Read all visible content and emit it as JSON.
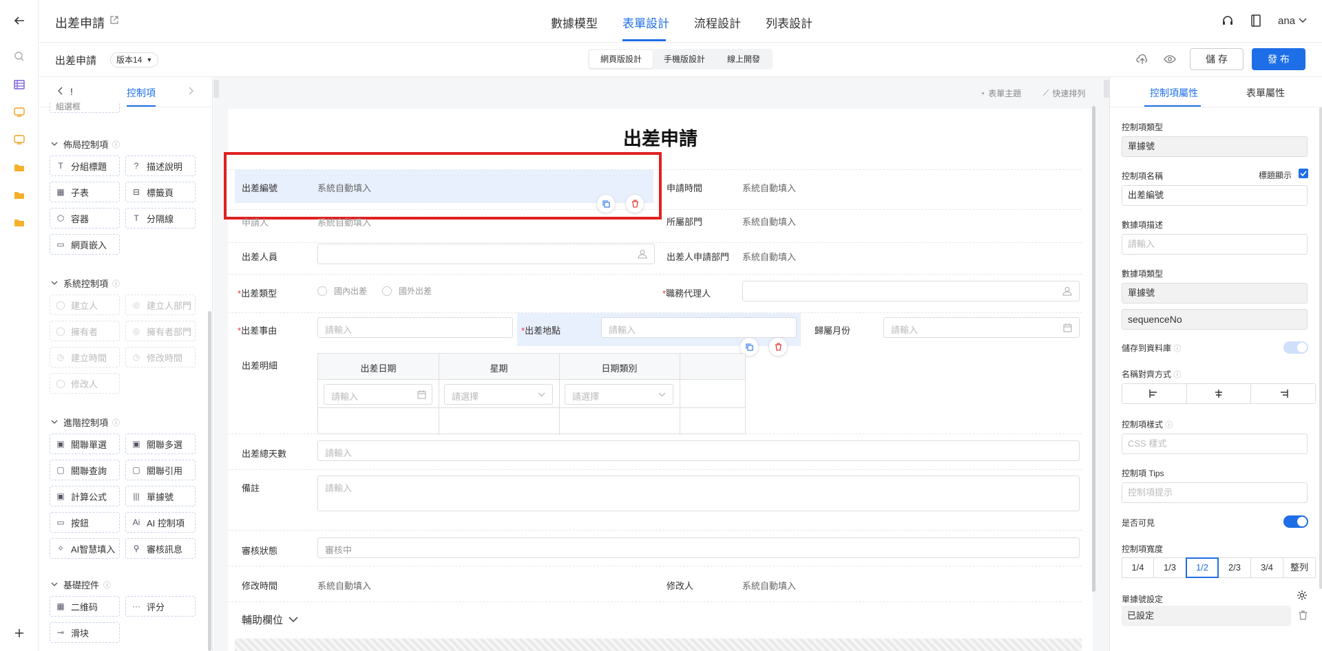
{
  "topbar": {
    "app_title": "出差申請",
    "tabs": [
      {
        "label": "數據模型",
        "active": false
      },
      {
        "label": "表單設計",
        "active": true
      },
      {
        "label": "流程設計",
        "active": false
      },
      {
        "label": "列表設計",
        "active": false
      }
    ],
    "user": "ana"
  },
  "subbar": {
    "form_name": "出差申請",
    "version": "版本14",
    "modes": [
      "網頁版設計",
      "手機版設計",
      "線上開發"
    ],
    "active_mode": "網頁版設計",
    "save_label": "儲 存",
    "publish_label": "發 布"
  },
  "palette": {
    "tab_left": "!",
    "tab_active": "控制項",
    "cut_item": "組選框",
    "sections": [
      {
        "title": "佈局控制項",
        "items": [
          {
            "icon": "T",
            "label": "分組標題",
            "disabled": false
          },
          {
            "icon": "?",
            "label": "描述說明",
            "disabled": false
          },
          {
            "icon": "▦",
            "label": "子表",
            "disabled": false
          },
          {
            "icon": "⊟",
            "label": "標籤頁",
            "disabled": false
          },
          {
            "icon": "⬡",
            "label": "容器",
            "disabled": false
          },
          {
            "icon": "T",
            "label": "分隔線",
            "disabled": false
          },
          {
            "icon": "▭",
            "label": "網頁嵌入",
            "disabled": false
          }
        ]
      },
      {
        "title": "系統控制項",
        "items": [
          {
            "icon": "◯",
            "label": "建立人",
            "disabled": true
          },
          {
            "icon": "◎",
            "label": "建立人部門",
            "disabled": true
          },
          {
            "icon": "◯",
            "label": "擁有者",
            "disabled": true
          },
          {
            "icon": "◎",
            "label": "擁有者部門",
            "disabled": true
          },
          {
            "icon": "◷",
            "label": "建立時間",
            "disabled": true
          },
          {
            "icon": "◷",
            "label": "修改時間",
            "disabled": true
          },
          {
            "icon": "◯",
            "label": "修改人",
            "disabled": true
          }
        ]
      },
      {
        "title": "進階控制項",
        "items": [
          {
            "icon": "▣",
            "label": "關聯單選",
            "disabled": false
          },
          {
            "icon": "▣",
            "label": "關聯多選",
            "disabled": false
          },
          {
            "icon": "▢",
            "label": "關聯查詢",
            "disabled": false
          },
          {
            "icon": "▢",
            "label": "關聯引用",
            "disabled": false
          },
          {
            "icon": "▣",
            "label": "計算公式",
            "disabled": false
          },
          {
            "icon": "|||",
            "label": "單據號",
            "disabled": false
          },
          {
            "icon": "▭",
            "label": "按鈕",
            "disabled": false
          },
          {
            "icon": "Ai",
            "label": "AI 控制項",
            "disabled": false
          },
          {
            "icon": "✧",
            "label": "AI智慧填入",
            "disabled": false
          },
          {
            "icon": "⚲",
            "label": "審核訊息",
            "disabled": false
          }
        ]
      },
      {
        "title": "基礎控件",
        "items": [
          {
            "icon": "▦",
            "label": "二维码",
            "disabled": false
          },
          {
            "icon": "···",
            "label": "评分",
            "disabled": false
          },
          {
            "icon": "⊸",
            "label": "滑块",
            "disabled": false
          }
        ]
      }
    ]
  },
  "canvas": {
    "theme_label": "表單主題",
    "arrange_label": "快速排列",
    "form_title": "出差申請",
    "fields": {
      "trip_no": {
        "label": "出差編號",
        "value": "系統自動填入"
      },
      "apply_time": {
        "label": "申請時間",
        "value": "系統自動填入"
      },
      "applicant": {
        "label": "申請人",
        "value": "系統自動填入"
      },
      "dept": {
        "label": "所屬部門",
        "value": "系統自動填入"
      },
      "traveler": {
        "label": "出差人員"
      },
      "traveler_dept": {
        "label": "出差人申請部門",
        "value": "系統自動填入"
      },
      "trip_type": {
        "label": "出差類型",
        "options": [
          "國內出差",
          "國外出差"
        ]
      },
      "agent": {
        "label": "職務代理人"
      },
      "reason": {
        "label": "出差事由",
        "placeholder": "請輸入"
      },
      "place": {
        "label": "出差地點",
        "placeholder": "請輸入"
      },
      "month": {
        "label": "歸屬月份",
        "placeholder": "請輸入"
      },
      "detail": {
        "label": "出差明細",
        "columns": [
          "出差日期",
          "星期",
          "日期類別"
        ],
        "date_ph": "請輸入",
        "select_ph": "請選擇"
      },
      "total_days": {
        "label": "出差總天數",
        "placeholder": "請輸入"
      },
      "remark": {
        "label": "備註",
        "placeholder": "請輸入"
      },
      "status": {
        "label": "審核狀態",
        "placeholder": "審核中"
      },
      "modify_time": {
        "label": "修改時間",
        "value": "系統自動填入"
      },
      "modifier": {
        "label": "修改人",
        "value": "系統自動填入"
      }
    },
    "aux_label": "輔助欄位"
  },
  "props": {
    "tabs": [
      "控制項屬性",
      "表單屬性"
    ],
    "active_tab": "控制項屬性",
    "type_label": "控制項類型",
    "type_value": "單據號",
    "name_label": "控制項名稱",
    "show_title_label": "標題顯示",
    "name_value": "出差編號",
    "desc_label": "數據項描述",
    "desc_placeholder": "請輸入",
    "data_type_label": "數據項類型",
    "data_type_value": "單據號",
    "data_key": "sequenceNo",
    "store_label": "儲存到資料庫",
    "align_label": "名稱對齊方式",
    "style_label": "控制項樣式",
    "style_placeholder": "CSS 樣式",
    "tips_label": "控制項 Tips",
    "tips_placeholder": "控制項提示",
    "visible_label": "是否可見",
    "width_label": "控制項寬度",
    "width_options": [
      "1/4",
      "1/3",
      "1/2",
      "2/3",
      "3/4",
      "整列"
    ],
    "width_selected": "1/2",
    "seq_label": "單據號設定",
    "seq_value": "已設定"
  },
  "colors": {
    "accent": "#1e6ee8",
    "highlight_border": "#e02020",
    "selected_bg": "#e8f0fd"
  }
}
